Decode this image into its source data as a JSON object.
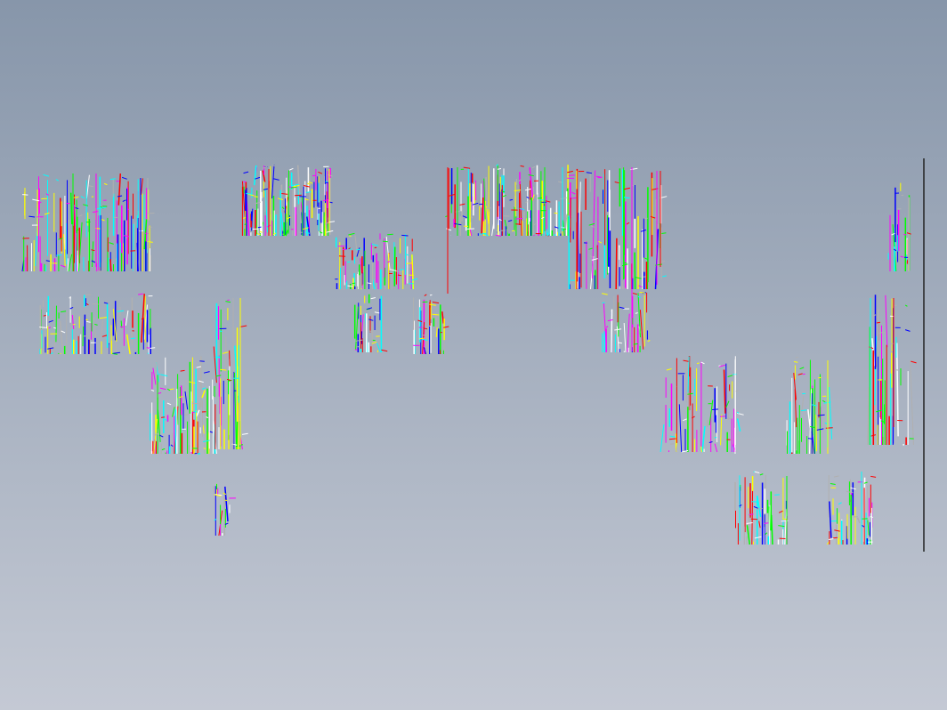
{
  "viewport": {
    "background_top": "#8796aa",
    "background_bottom": "#c4c9d4",
    "view_label": ""
  },
  "drawing": {
    "description_visible": false,
    "line_colors": [
      "#00ffff",
      "#ff0000",
      "#0000ff",
      "#00ff00",
      "#ff00ff",
      "#ffff00",
      "#ffffff",
      "#b0b0b0"
    ],
    "frame_border_color": "#222222"
  }
}
